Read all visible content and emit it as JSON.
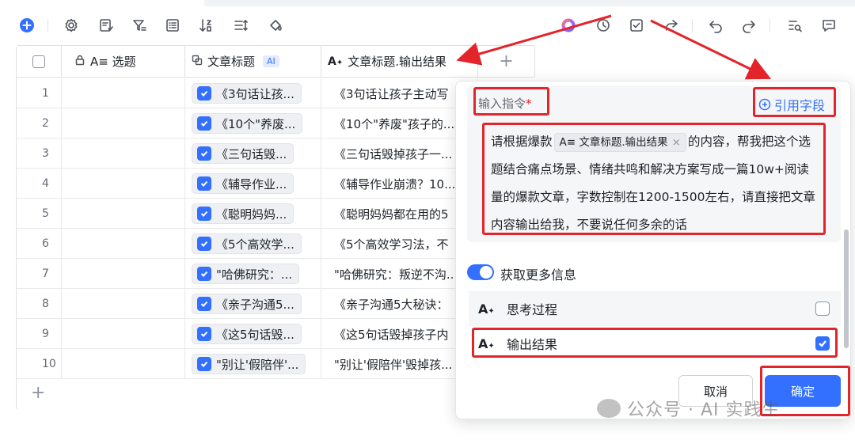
{
  "toolbar": {
    "icons": [
      "add-icon",
      "settings-icon",
      "field-manager-icon",
      "filter-icon",
      "group-icon",
      "sort-icon",
      "row-height-icon",
      "fill-color-icon",
      "ai-assistant-icon",
      "history-icon",
      "check-icon",
      "share-icon",
      "undo-icon",
      "redo-icon",
      "search-icon",
      "comment-icon"
    ]
  },
  "table": {
    "columns": [
      {
        "label": "A≡ 选题",
        "icon": "lock-icon"
      },
      {
        "label": "文章标题",
        "icon": "link-field-icon",
        "badge": "AI"
      },
      {
        "label": "文章标题.输出结果",
        "icon": "ai-text-icon"
      }
    ],
    "add_column": "+",
    "rows": [
      {
        "index": "1",
        "title": "《3句话让孩...",
        "result": "《3句话让孩子主动写"
      },
      {
        "index": "2",
        "title": "《10个\"养废...",
        "result": "《10个\"养废\"孩子的..."
      },
      {
        "index": "3",
        "title": "《三句话毁...",
        "result": "《三句话毁掉孩子一..."
      },
      {
        "index": "4",
        "title": "《辅导作业...",
        "result": "《辅导作业崩溃？10..."
      },
      {
        "index": "5",
        "title": "《聪明妈妈...",
        "result": "《聪明妈妈都在用的5"
      },
      {
        "index": "6",
        "title": "《5个高效学...",
        "result": "《5个高效学习法，不"
      },
      {
        "index": "7",
        "title": "\"哈佛研究：...",
        "result": "\"哈佛研究：叛逆不沟..."
      },
      {
        "index": "8",
        "title": "《亲子沟通5...",
        "result": "《亲子沟通5大秘诀："
      },
      {
        "index": "9",
        "title": "《这5句话毁...",
        "result": "《这5句话毁掉孩子内"
      },
      {
        "index": "10",
        "title": "\"别让'假陪伴'...",
        "result": "\"别让'假陪伴'毁掉孩..."
      }
    ],
    "add_row": "+"
  },
  "panel": {
    "prompt_label": "输入指令",
    "required_mark": "*",
    "ref_field": "引用字段",
    "prompt_before": "请根据爆款",
    "prompt_tag": "A≡ 文章标题.输出结果",
    "prompt_tag_close": "×",
    "prompt_after": "的内容，帮我把这个选题结合痛点场景、情绪共鸣和解决方案写成一篇10w+阅读量的爆款文章，字数控制在1200-1500左右，请直接把文章内容输出给我，不要说任何多余的话",
    "more_info": "获取更多信息",
    "options": [
      {
        "label": "思考过程",
        "checked": false
      },
      {
        "label": "输出结果",
        "checked": true
      }
    ],
    "cancel": "取消",
    "confirm": "确定"
  },
  "watermark": "公众号 · AI 实践生",
  "colors": {
    "accent": "#3370ff",
    "annotation": "#e3242b"
  }
}
